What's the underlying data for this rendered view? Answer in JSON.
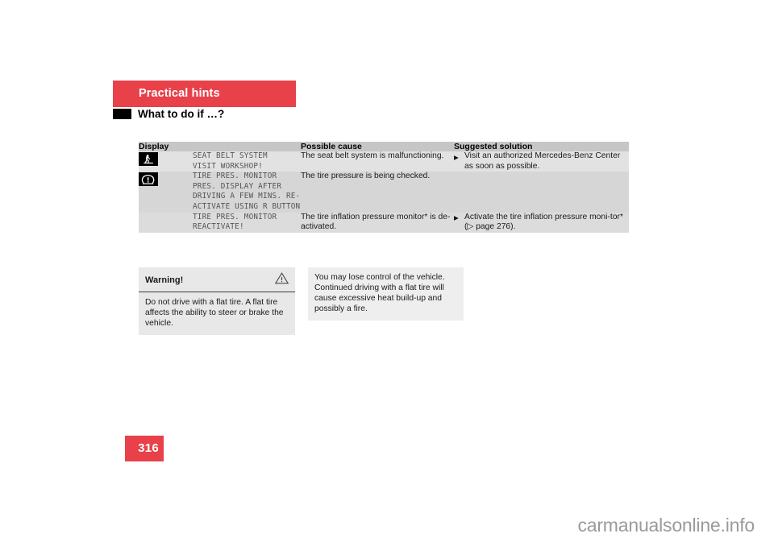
{
  "header": {
    "chapter": "Practical hints",
    "section": "What to do if …?"
  },
  "table": {
    "columns": [
      "Display",
      "Possible cause",
      "Suggested solution"
    ],
    "rows": [
      {
        "icon": "seat-belt-warning-icon",
        "display_text": "SEAT BELT SYSTEM\nVISIT WORKSHOP!",
        "cause": "The seat belt system is malfunctioning.",
        "solution": "Visit an authorized Mercedes-Benz Center as soon as possible.",
        "has_bullet": true
      },
      {
        "icon": "tire-pressure-warning-icon",
        "display_text": "TIRE PRES. MONITOR\nPRES. DISPLAY AFTER\nDRIVING A FEW MINS. RE-\nACTIVATE USING R BUTTON",
        "cause": "The tire pressure is being checked.",
        "solution": "",
        "has_bullet": false
      },
      {
        "icon": "",
        "display_text": "TIRE PRES. MONITOR\nREACTIVATE!",
        "cause": "The tire inflation pressure monitor* is de-activated.",
        "solution": "Activate the tire inflation pressure moni-tor* (▷ page 276).",
        "has_bullet": true
      }
    ]
  },
  "warning": {
    "title": "Warning!",
    "icon": "warning-triangle-icon",
    "body": "Do not drive with a flat tire. A flat tire affects the ability to steer or brake the vehicle.",
    "aside": "You may lose control of the vehicle. Continued driving with a flat tire will cause excessive heat build-up and possibly a fire."
  },
  "footer": {
    "page_number": "316",
    "watermark": "carmanualsonline.info"
  },
  "colors": {
    "brand_red": "#e8414a",
    "table_header_gray": "#c6c6c6",
    "row_light": "#e2e2e2",
    "row_dark": "#d6d6d6"
  }
}
